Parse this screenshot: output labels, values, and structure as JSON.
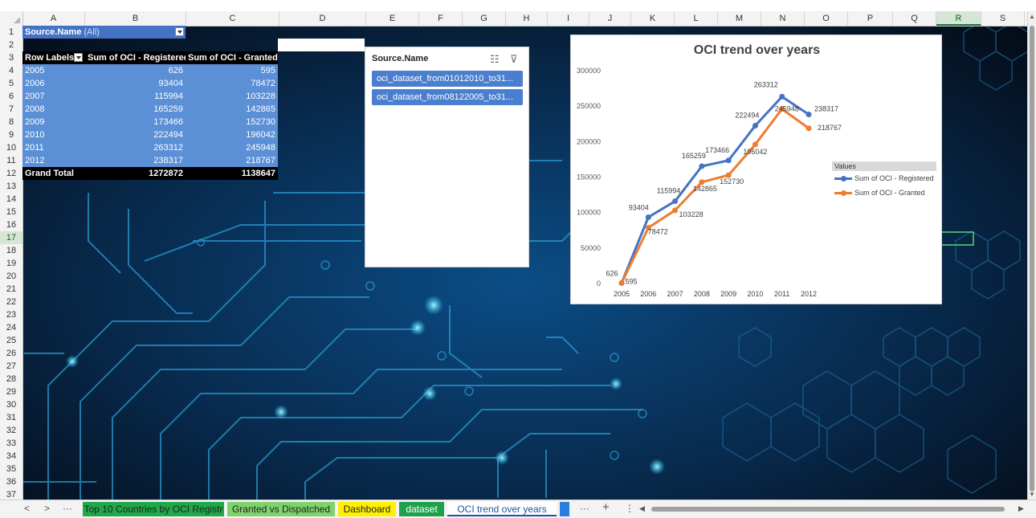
{
  "columns": [
    "A",
    "B",
    "C",
    "D",
    "E",
    "F",
    "G",
    "H",
    "I",
    "J",
    "K",
    "L",
    "M",
    "N",
    "O",
    "P",
    "Q",
    "R",
    "S"
  ],
  "selected_column": "R",
  "rows": [
    "1",
    "2",
    "3",
    "4",
    "5",
    "6",
    "7",
    "8",
    "9",
    "10",
    "11",
    "12",
    "13",
    "14",
    "15",
    "16",
    "17",
    "18",
    "19",
    "20",
    "21",
    "22",
    "23",
    "24",
    "25",
    "26",
    "27",
    "28",
    "29",
    "30",
    "31",
    "32",
    "33",
    "34",
    "35",
    "36",
    "37"
  ],
  "selected_row": "17",
  "pivot": {
    "filter_label": "Source.Name",
    "filter_value": "(All)",
    "col_row_labels": "Row Labels",
    "col_registered": "Sum of OCI - Registered",
    "col_granted": "Sum of OCI - Granted",
    "rows": [
      {
        "year": "2005",
        "registered": "626",
        "granted": "595"
      },
      {
        "year": "2006",
        "registered": "93404",
        "granted": "78472"
      },
      {
        "year": "2007",
        "registered": "115994",
        "granted": "103228"
      },
      {
        "year": "2008",
        "registered": "165259",
        "granted": "142865"
      },
      {
        "year": "2009",
        "registered": "173466",
        "granted": "152730"
      },
      {
        "year": "2010",
        "registered": "222494",
        "granted": "196042"
      },
      {
        "year": "2011",
        "registered": "263312",
        "granted": "245948"
      },
      {
        "year": "2012",
        "registered": "238317",
        "granted": "218767"
      }
    ],
    "total_label": "Grand Total",
    "total_registered": "1272872",
    "total_granted": "1138647"
  },
  "slicer": {
    "title": "Source.Name",
    "items": [
      "oci_dataset_from01012010_to31...",
      "oci_dataset_from08122005_to31..."
    ]
  },
  "chart_data": {
    "type": "line",
    "title": "OCI trend over years",
    "categories": [
      "2005",
      "2006",
      "2007",
      "2008",
      "2009",
      "2010",
      "2011",
      "2012"
    ],
    "series": [
      {
        "name": "Sum of OCI - Registered",
        "color": "#4472c4",
        "values": [
          626,
          93404,
          115994,
          165259,
          173466,
          222494,
          263312,
          238317
        ]
      },
      {
        "name": "Sum of OCI - Granted",
        "color": "#ed7d31",
        "values": [
          595,
          78472,
          103228,
          142865,
          152730,
          196042,
          245948,
          218767
        ]
      }
    ],
    "y_ticks": [
      "0",
      "50000",
      "100000",
      "150000",
      "200000",
      "250000",
      "300000"
    ],
    "ylim": [
      0,
      300000
    ],
    "legend_title": "Values",
    "legend_position": "right",
    "grid": false
  },
  "tabs": [
    {
      "label": "Top 10 Countries by OCI Registr",
      "color": "#20a84a",
      "text": "#222"
    },
    {
      "label": "Granted vs Dispatched",
      "color": "#7ed36b",
      "text": "#222"
    },
    {
      "label": "Dashboard",
      "color": "#ffef00",
      "text": "#222"
    },
    {
      "label": "dataset",
      "color": "#1fa04c",
      "text": "#fff"
    },
    {
      "label": "OCI trend over years",
      "color": "#ffffff",
      "text": "#1a56a6",
      "active": true
    },
    {
      "label": "",
      "color": "#2a7de1",
      "text": "#fff"
    }
  ],
  "tab_nav": {
    "prev": "<",
    "next": ">",
    "more": "···",
    "more2": "···",
    "add": "+",
    "menu": "⋮"
  }
}
